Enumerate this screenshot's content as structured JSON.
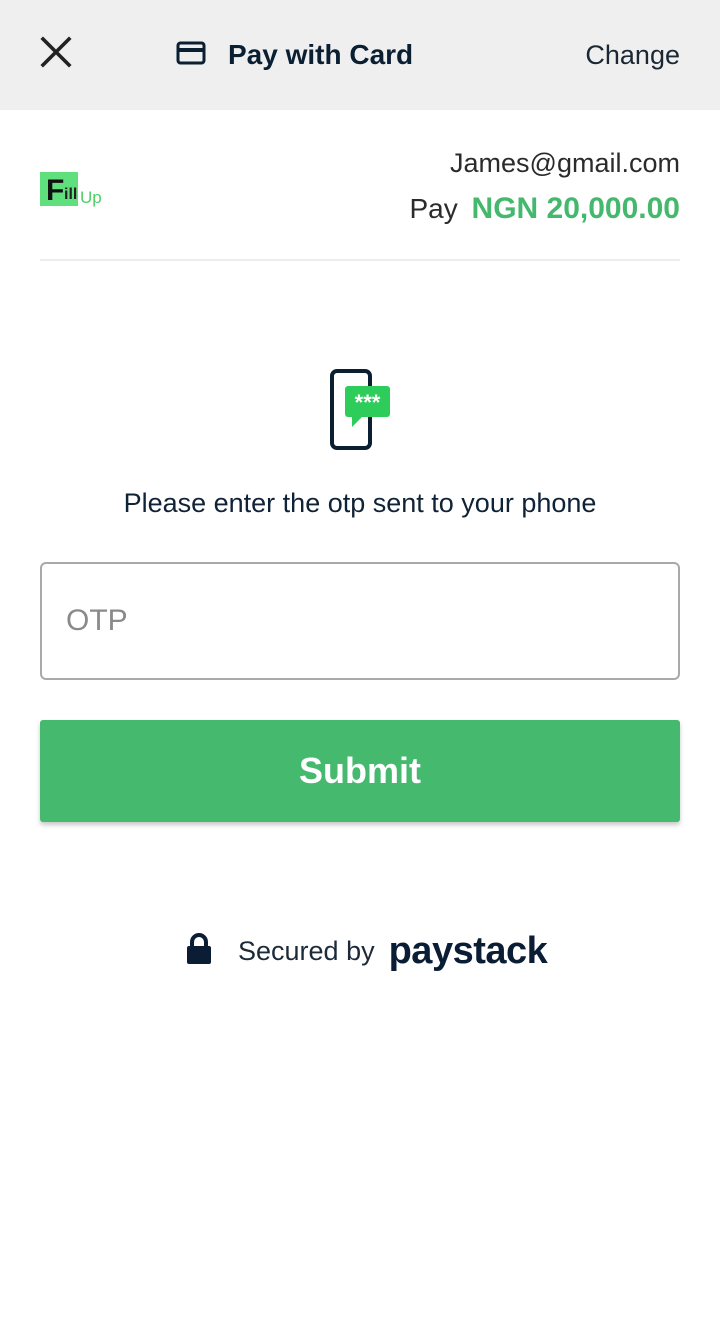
{
  "header": {
    "close_icon": "close-icon",
    "card_icon": "credit-card-icon",
    "title": "Pay with Card",
    "change_label": "Change"
  },
  "merchant": {
    "logo_letter": "F",
    "logo_part2": "ill",
    "logo_part3": "Up",
    "brand_color": "#5fe07d"
  },
  "customer": {
    "email": "James@gmail.com",
    "pay_label": "Pay",
    "amount": "NGN 20,000.00"
  },
  "otp": {
    "icon": "phone-otp-icon",
    "bubble_text": "***",
    "instruction": "Please enter the otp sent to your phone",
    "placeholder": "OTP",
    "value": "",
    "submit_label": "Submit"
  },
  "footer": {
    "lock_icon": "lock-icon",
    "secured_label": "Secured by",
    "brand": "paystack"
  },
  "colors": {
    "accent": "#45b96e",
    "header_bg": "#efefef",
    "dark_text": "#0b1f33"
  }
}
